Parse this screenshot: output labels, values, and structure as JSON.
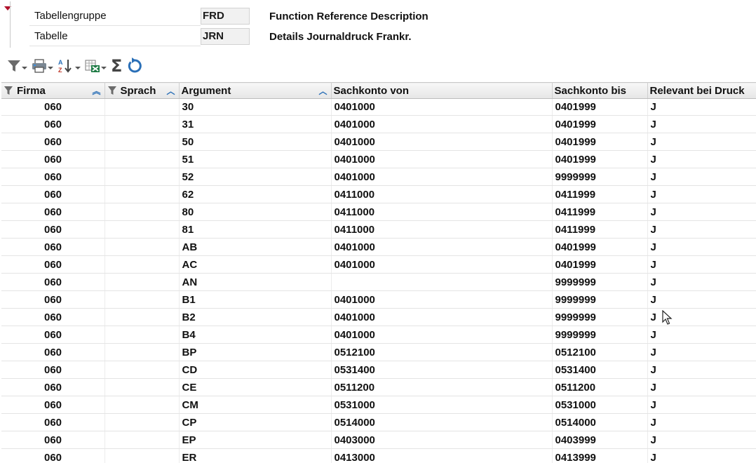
{
  "header": {
    "table_group_label": "Tabellengruppe",
    "table_group_value": "FRD",
    "table_group_desc": "Function Reference Description",
    "table_label": "Tabelle",
    "table_value": "JRN",
    "table_desc": "Details Journaldruck Frankr."
  },
  "toolbar": {
    "icons": [
      "filter-icon",
      "print-icon",
      "sort-az-icon",
      "excel-export-icon",
      "sum-icon",
      "refresh-icon"
    ],
    "sum_glyph": "Σ"
  },
  "grid": {
    "columns": [
      {
        "key": "firma",
        "label": "Firma",
        "filter": true,
        "sort": "asc-double"
      },
      {
        "key": "sprach",
        "label": "Sprach",
        "filter": true,
        "sort": "asc"
      },
      {
        "key": "argument",
        "label": "Argument",
        "filter": false,
        "sort": "asc"
      },
      {
        "key": "von",
        "label": "Sachkonto von",
        "filter": false,
        "sort": ""
      },
      {
        "key": "bis",
        "label": "Sachkonto bis",
        "filter": false,
        "sort": ""
      },
      {
        "key": "rel",
        "label": "Relevant bei Druck",
        "filter": false,
        "sort": ""
      }
    ],
    "rows": [
      [
        "060",
        "",
        "30",
        "0401000",
        "0401999",
        "J"
      ],
      [
        "060",
        "",
        "31",
        "0401000",
        "0401999",
        "J"
      ],
      [
        "060",
        "",
        "50",
        "0401000",
        "0401999",
        "J"
      ],
      [
        "060",
        "",
        "51",
        "0401000",
        "0401999",
        "J"
      ],
      [
        "060",
        "",
        "52",
        "0401000",
        "9999999",
        "J"
      ],
      [
        "060",
        "",
        "62",
        "0411000",
        "0411999",
        "J"
      ],
      [
        "060",
        "",
        "80",
        "0411000",
        "0411999",
        "J"
      ],
      [
        "060",
        "",
        "81",
        "0411000",
        "0411999",
        "J"
      ],
      [
        "060",
        "",
        "AB",
        "0401000",
        "0401999",
        "J"
      ],
      [
        "060",
        "",
        "AC",
        "0401000",
        "0401999",
        "J"
      ],
      [
        "060",
        "",
        "AN",
        "",
        "9999999",
        "J"
      ],
      [
        "060",
        "",
        "B1",
        "0401000",
        "9999999",
        "J"
      ],
      [
        "060",
        "",
        "B2",
        "0401000",
        "9999999",
        "J"
      ],
      [
        "060",
        "",
        "B4",
        "0401000",
        "9999999",
        "J"
      ],
      [
        "060",
        "",
        "BP",
        "0512100",
        "0512100",
        "J"
      ],
      [
        "060",
        "",
        "CD",
        "0531400",
        "0531400",
        "J"
      ],
      [
        "060",
        "",
        "CE",
        "0511200",
        "0511200",
        "J"
      ],
      [
        "060",
        "",
        "CM",
        "0531000",
        "0531000",
        "J"
      ],
      [
        "060",
        "",
        "CP",
        "0514000",
        "0514000",
        "J"
      ],
      [
        "060",
        "",
        "EP",
        "0403000",
        "0403999",
        "J"
      ],
      [
        "060",
        "",
        "ER",
        "0413000",
        "0413999",
        "J"
      ]
    ]
  }
}
